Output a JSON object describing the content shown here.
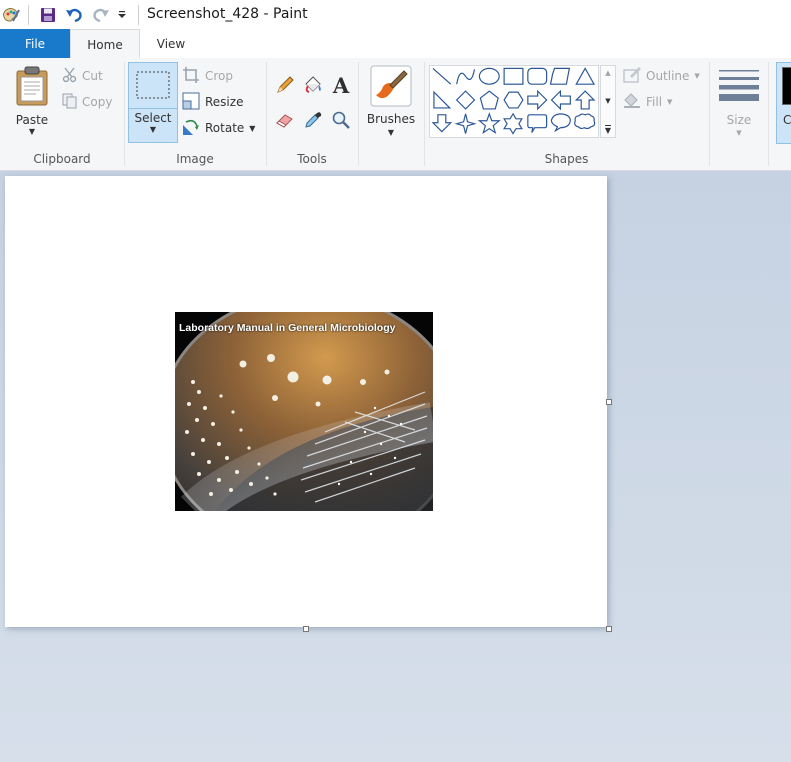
{
  "window": {
    "title": "Screenshot_428 - Paint"
  },
  "quick_access": {
    "app_icon": "paint-palette-icon",
    "save_icon": "floppy-disk-icon",
    "undo_icon": "undo-arrow-icon",
    "redo_icon": "redo-arrow-icon",
    "customize_icon": "dropdown-arrow-icon"
  },
  "tabs": {
    "file": "File",
    "home": "Home",
    "view": "View"
  },
  "clipboard": {
    "paste": "Paste",
    "cut": "Cut",
    "copy": "Copy",
    "group": "Clipboard"
  },
  "image": {
    "select": "Select",
    "crop": "Crop",
    "resize": "Resize",
    "rotate": "Rotate",
    "group": "Image"
  },
  "tools": {
    "group": "Tools",
    "items": [
      "pencil-icon",
      "fill-bucket-icon",
      "text-icon",
      "eraser-icon",
      "color-picker-icon",
      "magnifier-icon"
    ]
  },
  "brushes": {
    "label": "Brushes"
  },
  "shapes": {
    "group": "Shapes",
    "outline": "Outline",
    "fill": "Fill",
    "items": [
      "line",
      "curve",
      "oval",
      "rectangle",
      "rounded-rectangle",
      "polygon",
      "triangle",
      "right-triangle",
      "diamond",
      "pentagon",
      "hexagon",
      "right-arrow",
      "left-arrow",
      "up-arrow",
      "down-arrow",
      "four-point-star",
      "five-point-star",
      "six-point-star",
      "rounded-rectangular-callout",
      "oval-callout",
      "cloud-callout"
    ]
  },
  "size": {
    "label": "Size"
  },
  "colors": {
    "color1": "C",
    "accent": "#1979ca",
    "selected_bg": "#cce4f7"
  },
  "canvas": {
    "photo_caption": "Laboratory Manual in General Microbiology"
  }
}
